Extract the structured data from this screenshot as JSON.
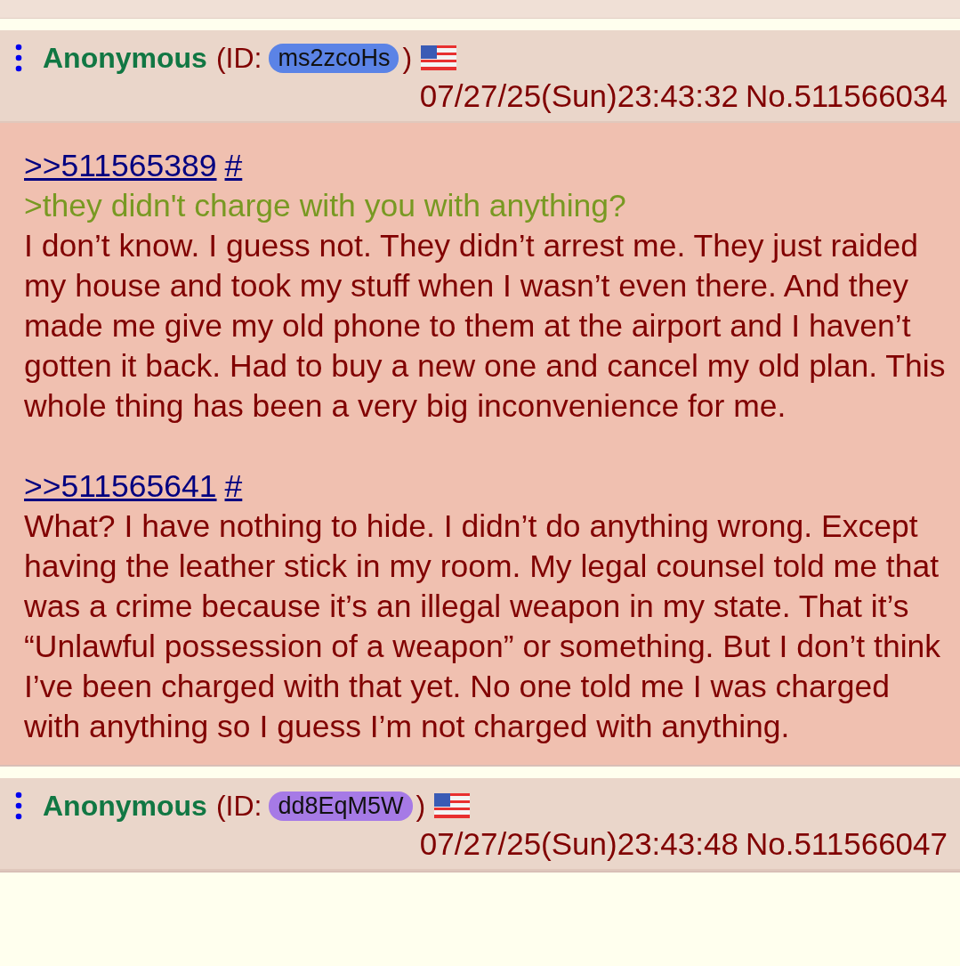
{
  "posts": [
    {
      "name": "Anonymous",
      "id_prefix": "(ID:",
      "id": "ms2zcoHs",
      "id_suffix": ")",
      "color": "#5b83e6",
      "date": "07/27/25(Sun)23:43:32",
      "number": "No.511566034",
      "highlighted": true,
      "blocks": [
        {
          "kind": "quotelink",
          "target": ">>511565389",
          "anchor": "#"
        },
        {
          "kind": "greentext",
          "text": ">they didn't charge with you with anything?"
        },
        {
          "kind": "text",
          "text": "I don’t know. I guess not. They didn’t arrest me. They just raided my house and took my stuff when I wasn’t even there. And they made me give my old phone to them at the airport and I haven’t gotten it back. Had to buy a new one and cancel my old plan. This whole thing has been a very big inconvenience for me."
        },
        {
          "kind": "gap"
        },
        {
          "kind": "quotelink",
          "target": ">>511565641",
          "anchor": "#"
        },
        {
          "kind": "text",
          "text": "What? I have nothing to hide. I didn’t do anything wrong. Except having the leather stick in my room. My legal counsel told me that was a crime because it’s an illegal weapon in my state. That it’s “Unlawful possession of a weapon” or something. But I don’t think I’ve been charged with that yet. No one told me I was charged with anything so I guess I’m not charged with anything."
        }
      ]
    },
    {
      "name": "Anonymous",
      "id_prefix": "(ID:",
      "id": "dd8EqM5W",
      "id_suffix": ")",
      "color": "#a67ae6",
      "date": "07/27/25(Sun)23:43:48",
      "number": "No.511566047"
    }
  ]
}
